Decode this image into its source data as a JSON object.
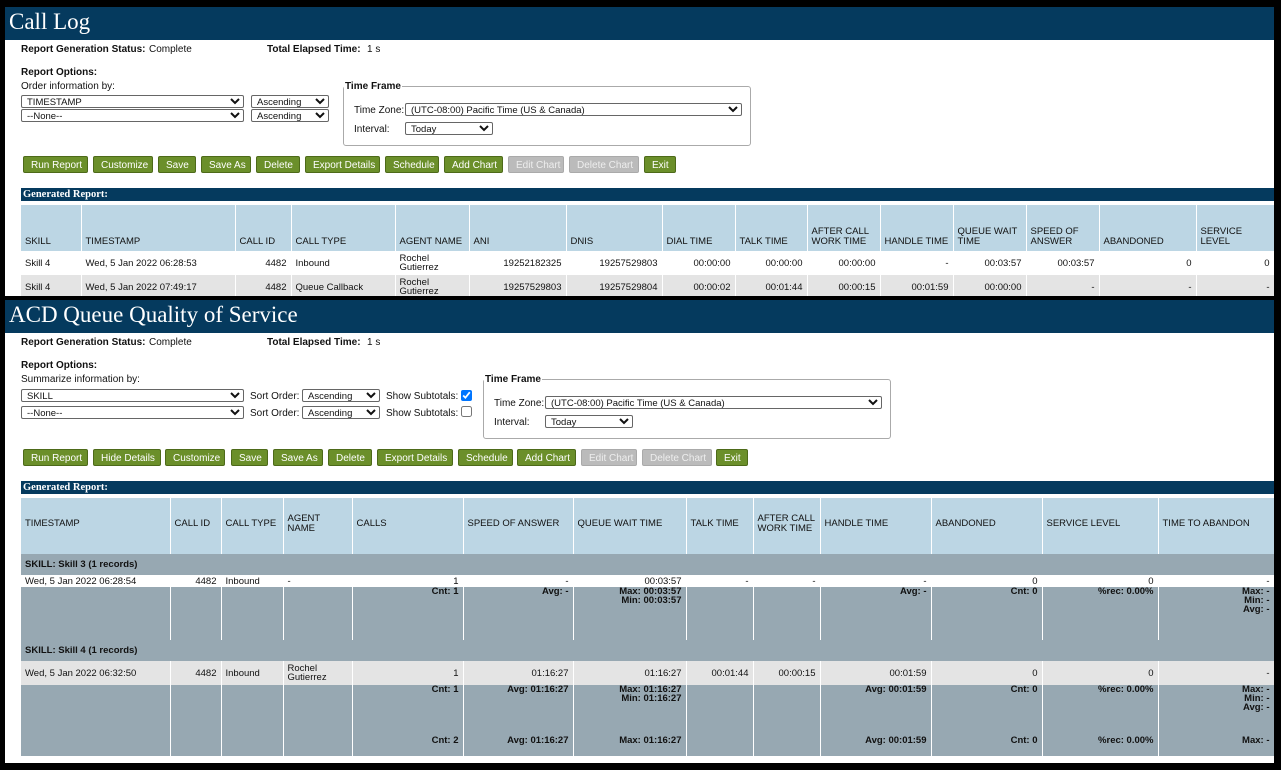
{
  "call_log": {
    "title": "Call Log",
    "status_label": "Report Generation Status:",
    "status_value": "Complete",
    "elapsed_label": "Total Elapsed Time:",
    "elapsed_value": "1 s",
    "options_label": "Report Options:",
    "order_label": "Order information by:",
    "order1": "TIMESTAMP",
    "order1_dir": "Ascending",
    "order2": "--None--",
    "order2_dir": "Ascending",
    "timeframe": {
      "legend": "Time Frame",
      "tz_label": "Time Zone:",
      "tz_value": "(UTC-08:00) Pacific Time (US & Canada)",
      "interval_label": "Interval:",
      "interval_value": "Today"
    },
    "buttons": [
      "Run Report",
      "Customize",
      "Save",
      "Save As",
      "Delete",
      "Export Details",
      "Schedule",
      "Add Chart",
      "Edit Chart",
      "Delete Chart",
      "Exit"
    ],
    "generated_label": "Generated Report:",
    "columns": [
      "SKILL",
      "TIMESTAMP",
      "CALL ID",
      "CALL TYPE",
      "AGENT NAME",
      "ANI",
      "DNIS",
      "DIAL TIME",
      "TALK TIME",
      "AFTER CALL WORK TIME",
      "HANDLE TIME",
      "QUEUE WAIT TIME",
      "SPEED OF ANSWER",
      "ABANDONED",
      "SERVICE LEVEL"
    ],
    "rows": [
      [
        "Skill 4",
        "Wed, 5 Jan 2022 06:28:53",
        "4482",
        "Inbound",
        "Rochel Gutierrez",
        "19252182325",
        "19257529803",
        "00:00:00",
        "00:00:00",
        "00:00:00",
        "-",
        "00:03:57",
        "00:03:57",
        "0",
        "0"
      ],
      [
        "Skill 4",
        "Wed, 5 Jan 2022 07:49:17",
        "4482",
        "Queue Callback",
        "Rochel Gutierrez",
        "19257529803",
        "19257529804",
        "00:00:02",
        "00:01:44",
        "00:00:15",
        "00:01:59",
        "00:00:00",
        "-",
        "-",
        "-"
      ]
    ]
  },
  "acd": {
    "title": "ACD Queue Quality of Service",
    "status_label": "Report Generation Status:",
    "status_value": "Complete",
    "elapsed_label": "Total Elapsed Time:",
    "elapsed_value": "1 s",
    "options_label": "Report Options:",
    "summ_label": "Summarize information by:",
    "summ1": "SKILL",
    "summ2": "--None--",
    "sort_label": "Sort Order:",
    "sort1": "Ascending",
    "sort2": "Ascending",
    "subtotals_label": "Show Subtotals:",
    "subtotals1": true,
    "subtotals2": false,
    "timeframe": {
      "legend": "Time Frame",
      "tz_label": "Time Zone:",
      "tz_value": "(UTC-08:00) Pacific Time (US & Canada)",
      "interval_label": "Interval:",
      "interval_value": "Today"
    },
    "buttons": [
      "Run Report",
      "Hide Details",
      "Customize",
      "Save",
      "Save As",
      "Delete",
      "Export Details",
      "Schedule",
      "Add Chart",
      "Edit Chart",
      "Delete Chart",
      "Exit"
    ],
    "generated_label": "Generated Report:",
    "columns": [
      "TIMESTAMP",
      "CALL ID",
      "CALL TYPE",
      "AGENT NAME",
      "CALLS",
      "SPEED OF ANSWER",
      "QUEUE WAIT TIME",
      "TALK TIME",
      "AFTER CALL WORK TIME",
      "HANDLE TIME",
      "ABANDONED",
      "SERVICE LEVEL",
      "TIME TO ABANDON"
    ],
    "groups": [
      {
        "label": "SKILL:  Skill 3 (1 records)",
        "row": [
          "Wed, 5 Jan 2022 06:28:54",
          "4482",
          "Inbound",
          "-",
          "1",
          "-",
          "00:03:57",
          "-",
          "-",
          "-",
          "0",
          "0",
          "-"
        ],
        "subtotal": [
          "",
          "",
          "",
          "",
          "Cnt: 1",
          "Avg: -",
          "Max: 00:03:57\nMin: 00:03:57",
          "",
          "",
          "Avg: -",
          "Cnt: 0",
          "%rec: 0.00%",
          "Max: -\nMin: -\nAvg: -"
        ]
      },
      {
        "label": "SKILL:  Skill 4 (1 records)",
        "row": [
          "Wed, 5 Jan 2022 06:32:50",
          "4482",
          "Inbound",
          "Rochel Gutierrez",
          "1",
          "01:16:27",
          "01:16:27",
          "00:01:44",
          "00:00:15",
          "00:01:59",
          "0",
          "0",
          "-"
        ],
        "subtotal": [
          "",
          "",
          "",
          "",
          "Cnt: 1",
          "Avg: 01:16:27",
          "Max: 01:16:27\nMin: 01:16:27",
          "",
          "",
          "Avg: 00:01:59",
          "Cnt: 0",
          "%rec: 0.00%",
          "Max: -\nMin: -\nAvg: -"
        ]
      }
    ],
    "grand_total": [
      "",
      "",
      "",
      "",
      "Cnt: 2",
      "Avg: 01:16:27",
      "Max: 01:16:27",
      "",
      "",
      "Avg: 00:01:59",
      "Cnt: 0",
      "%rec: 0.00%",
      "Max: -"
    ]
  },
  "colors": {
    "header_bg": "#053a5e",
    "button_bg": "#6b8f2a",
    "table_header_bg": "#bcd6e4",
    "group_bg": "#97a8b2"
  }
}
